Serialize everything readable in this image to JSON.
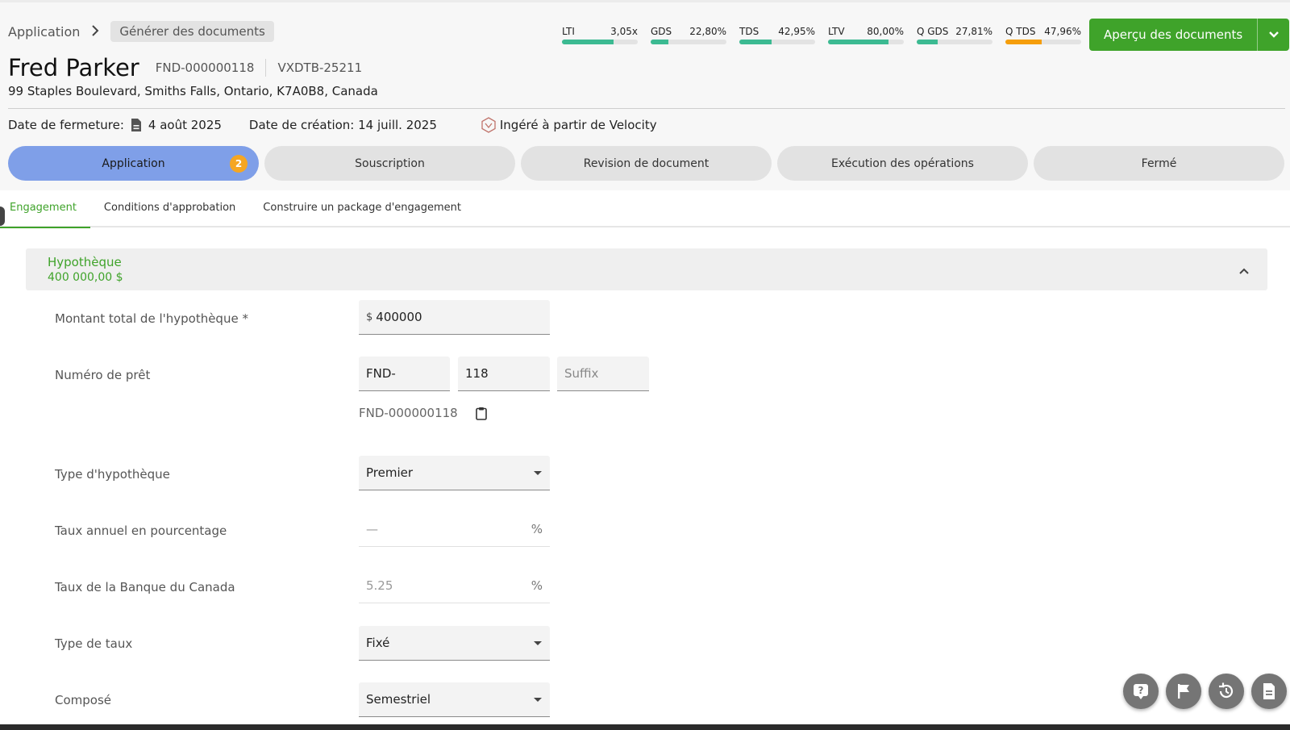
{
  "breadcrumb": {
    "root": "Application",
    "current": "Générer des documents"
  },
  "metrics": [
    {
      "name": "LTI",
      "value": "3,05x",
      "level": 0.68,
      "color": "#3cba92"
    },
    {
      "name": "GDS",
      "value": "22,80%",
      "level": 0.23,
      "color": "#3cba92"
    },
    {
      "name": "TDS",
      "value": "42,95%",
      "level": 0.43,
      "color": "#3cba92"
    },
    {
      "name": "LTV",
      "value": "80,00%",
      "level": 0.8,
      "color": "#3cba92"
    },
    {
      "name": "Q GDS",
      "value": "27,81%",
      "level": 0.28,
      "color": "#3cba92"
    },
    {
      "name": "Q TDS",
      "value": "47,96%",
      "level": 0.48,
      "color": "#f59e0b"
    }
  ],
  "preview_button": {
    "label": "Aperçu des documents"
  },
  "client": {
    "name": "Fred Parker",
    "ref1": "FND-000000118",
    "ref2": "VXDTB-25211",
    "address": "99 Staples Boulevard, Smiths Falls, Ontario, K7A0B8, Canada"
  },
  "dates": {
    "closing_label": "Date de fermeture:",
    "closing_value": "4 août 2025",
    "creation": "Date de création: 14 juill. 2025",
    "source": "Ingéré à partir de Velocity"
  },
  "steps": [
    {
      "label": "Application",
      "badge": "2"
    },
    {
      "label": "Souscription"
    },
    {
      "label": "Revision de document"
    },
    {
      "label": "Exécution des opérations"
    },
    {
      "label": "Fermé"
    }
  ],
  "tabs": [
    "Engagement",
    "Conditions d'approbation",
    "Construire un package d'engagement"
  ],
  "section": {
    "title": "Hypothèque",
    "amount": "400 000,00 $"
  },
  "form": {
    "total_label": "Montant total de l'hypothèque *",
    "total_prefix": "$",
    "total_value": "400000",
    "loan_label": "Numéro de prêt",
    "loan_prefix": "FND-",
    "loan_number": "118",
    "loan_suffix_placeholder": "Suffix",
    "loan_code": "FND-000000118",
    "type_label": "Type d'hypothèque",
    "type_value": "Premier",
    "apr_label": "Taux annuel en pourcentage",
    "apr_value": "—",
    "boc_label": "Taux de la Banque du Canada",
    "boc_value": "5.25",
    "pct": "%",
    "rate_type_label": "Type de taux",
    "rate_type_value": "Fixé",
    "compound_label": "Composé",
    "compound_value": "Semestriel"
  },
  "accent_color": "#3fa32a",
  "active_step_color": "#7f9fe8"
}
